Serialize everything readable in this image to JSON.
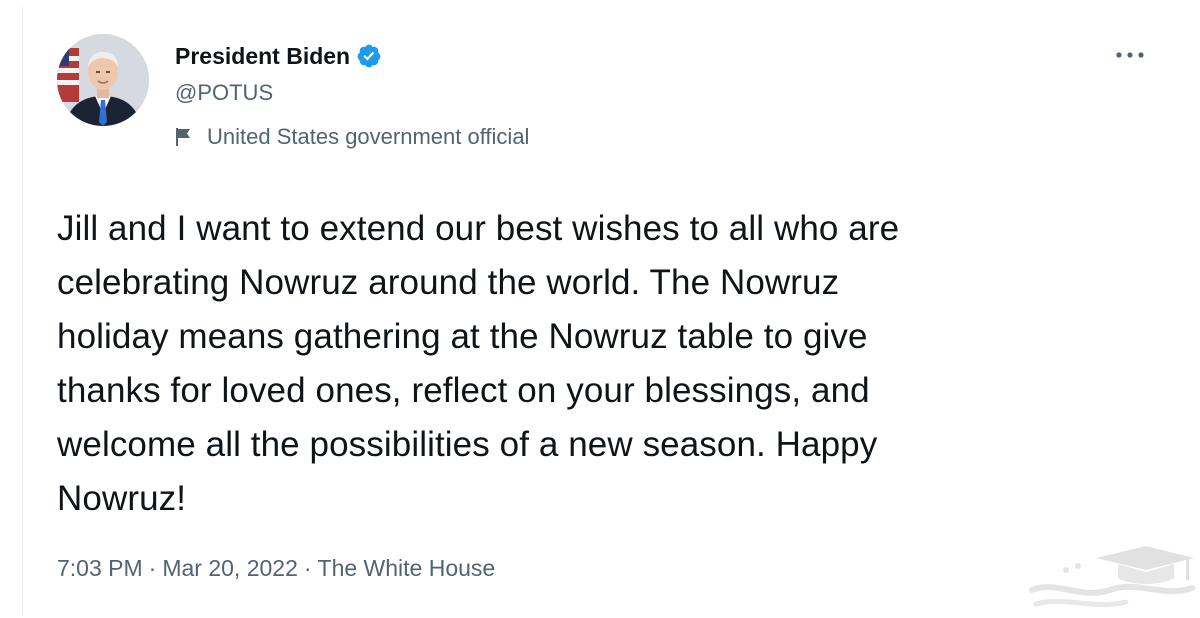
{
  "tweet": {
    "author": {
      "display_name": "President Biden",
      "handle": "@POTUS",
      "verified": true,
      "label": "United States government official"
    },
    "text": "Jill and I want to extend our best wishes to all who are\ncelebrating Nowruz around the world. The Nowruz\nholiday means gathering at the Nowruz table to give\nthanks for loved ones, reflect on your blessings, and\nwelcome all the possibilities of a new season. Happy\nNowruz!",
    "meta": {
      "time": "7:03 PM",
      "separator": "·",
      "date": "Mar 20, 2022",
      "source": "The White House"
    }
  },
  "icons": {
    "avatar": "avatar-photo",
    "verified": "verified-badge-icon",
    "label": "flag-icon",
    "more": "more-options-icon",
    "watermark": "graduation-cap-watermark"
  },
  "colors": {
    "text_primary": "#0f1419",
    "text_secondary": "#536471",
    "verified_blue": "#1d9bf0",
    "background": "#ffffff"
  }
}
